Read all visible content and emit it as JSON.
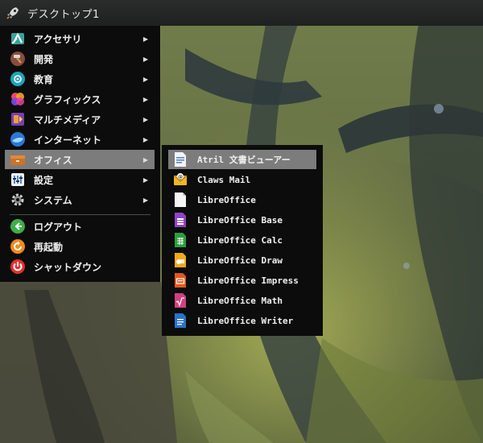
{
  "panel": {
    "title": "デスクトップ1",
    "launcher_icon": "rocket-icon"
  },
  "menu": {
    "items": [
      {
        "label": "アクセサリ",
        "icon": "accessories-icon",
        "has_submenu": true
      },
      {
        "label": "開発",
        "icon": "hammer-icon",
        "has_submenu": true
      },
      {
        "label": "教育",
        "icon": "education-icon",
        "has_submenu": true
      },
      {
        "label": "グラフィックス",
        "icon": "graphics-icon",
        "has_submenu": true
      },
      {
        "label": "マルチメディア",
        "icon": "multimedia-icon",
        "has_submenu": true
      },
      {
        "label": "インターネット",
        "icon": "internet-icon",
        "has_submenu": true
      },
      {
        "label": "オフィス",
        "icon": "office-icon",
        "has_submenu": true,
        "active": true
      },
      {
        "label": "設定",
        "icon": "settings-icon",
        "has_submenu": true
      },
      {
        "label": "システム",
        "icon": "system-gear-icon",
        "has_submenu": true
      }
    ],
    "session": [
      {
        "label": "ログアウト",
        "icon": "logout-icon"
      },
      {
        "label": "再起動",
        "icon": "restart-icon"
      },
      {
        "label": "シャットダウン",
        "icon": "power-icon"
      }
    ],
    "arrow_glyph": "▶"
  },
  "submenu": {
    "items": [
      {
        "label": "Atril 文書ビューアー",
        "icon": "document-viewer-icon",
        "active": true
      },
      {
        "label": "Claws Mail",
        "icon": "mail-icon"
      },
      {
        "label": "LibreOffice",
        "icon": "libreoffice-icon"
      },
      {
        "label": "LibreOffice Base",
        "icon": "libreoffice-base-icon"
      },
      {
        "label": "LibreOffice Calc",
        "icon": "libreoffice-calc-icon"
      },
      {
        "label": "LibreOffice Draw",
        "icon": "libreoffice-draw-icon"
      },
      {
        "label": "LibreOffice Impress",
        "icon": "libreoffice-impress-icon"
      },
      {
        "label": "LibreOffice Math",
        "icon": "libreoffice-math-icon"
      },
      {
        "label": "LibreOffice Writer",
        "icon": "libreoffice-writer-icon"
      }
    ]
  }
}
